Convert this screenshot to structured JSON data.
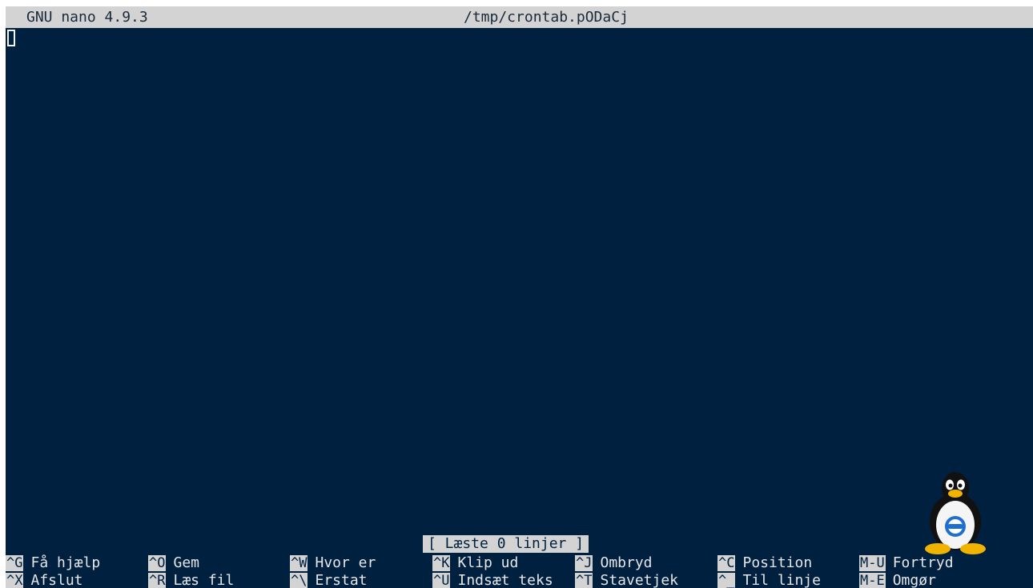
{
  "titlebar": {
    "version": "GNU nano 4.9.3",
    "filename": "/tmp/crontab.pODaCj"
  },
  "status": {
    "message": "[ Læste 0 linjer ]"
  },
  "shortcuts": {
    "row1": [
      {
        "key": "^G",
        "label": "Få hjælp"
      },
      {
        "key": "^O",
        "label": "Gem"
      },
      {
        "key": "^W",
        "label": "Hvor er"
      },
      {
        "key": "^K",
        "label": "Klip ud"
      },
      {
        "key": "^J",
        "label": "Ombryd"
      },
      {
        "key": "^C",
        "label": "Position"
      },
      {
        "key": "M-U",
        "label": "Fortryd"
      }
    ],
    "row2": [
      {
        "key": "^X",
        "label": "Afslut"
      },
      {
        "key": "^R",
        "label": "Læs fil"
      },
      {
        "key": "^\\",
        "label": "Erstat"
      },
      {
        "key": "^U",
        "label": "Indsæt teks"
      },
      {
        "key": "^T",
        "label": "Stavetjek"
      },
      {
        "key": "^_",
        "label": "Til linje"
      },
      {
        "key": "M-E",
        "label": "Omgør"
      }
    ]
  },
  "colors": {
    "background": "#002040",
    "bar": "#d3d3d3",
    "text": "#e6e6e6"
  },
  "icons": {
    "watermark": "tux-penguin-icon"
  }
}
